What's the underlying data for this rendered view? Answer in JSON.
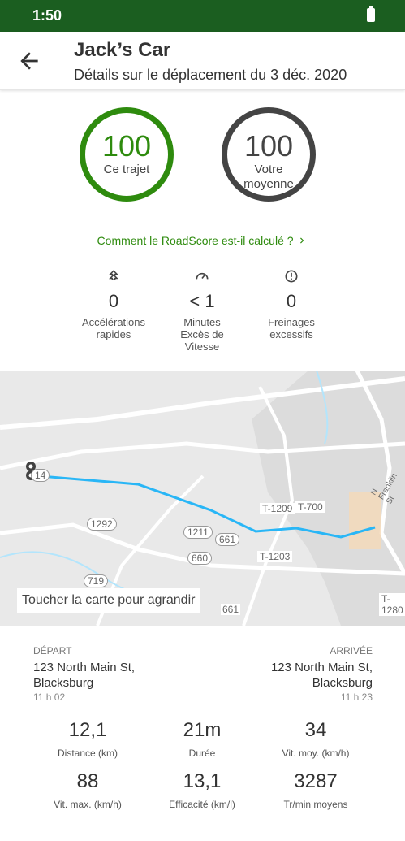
{
  "status_bar": {
    "time": "1:50",
    "battery_icon": "battery-full-icon"
  },
  "header": {
    "title": "Jack’s Car",
    "subtitle": "Détails sur le déplacement du 3 déc. 2020",
    "back_icon": "arrow-back-icon"
  },
  "scores": {
    "trip": {
      "value": "100",
      "label": "Ce trajet",
      "color": "#2e8b0e"
    },
    "average": {
      "value": "100",
      "label": "Votre moyenne",
      "color": "#444444"
    }
  },
  "roadscore_link": {
    "label": "Comment le RoadScore est-il calculé ?",
    "icon": "chevron-right-icon"
  },
  "events": [
    {
      "icon": "acceleration-icon",
      "value": "0",
      "label": "Accélérations rapides"
    },
    {
      "icon": "speedometer-icon",
      "value": "< 1",
      "label": "Minutes Excès de Vitesse"
    },
    {
      "icon": "alert-circle-icon",
      "value": "0",
      "label": "Freinages excessifs"
    }
  ],
  "map": {
    "hint": "Toucher la carte pour agrandir",
    "route_color": "#29b6f6",
    "road_labels": [
      "14",
      "1292",
      "1211",
      "661",
      "660",
      "719",
      "661",
      "T-1209",
      "T-700",
      "T-1203",
      "T-1280",
      "N Franklin St"
    ]
  },
  "departure": {
    "label": "DÉPART",
    "address_line1": "123 North Main St,",
    "address_line2": "Blacksburg",
    "time": "11 h 02"
  },
  "arrival": {
    "label": "ARRIVÉE",
    "address_line1": "123 North Main St,",
    "address_line2": "Blacksburg",
    "time": "11 h 23"
  },
  "trip_stats": [
    {
      "value": "12,1",
      "label": "Distance (km)"
    },
    {
      "value": "21m",
      "label": "Durée"
    },
    {
      "value": "34",
      "label": "Vit. moy. (km/h)"
    },
    {
      "value": "88",
      "label": "Vit. max. (km/h)"
    },
    {
      "value": "13,1",
      "label": "Efficacité (km/l)"
    },
    {
      "value": "3287",
      "label": "Tr/min moyens"
    }
  ]
}
